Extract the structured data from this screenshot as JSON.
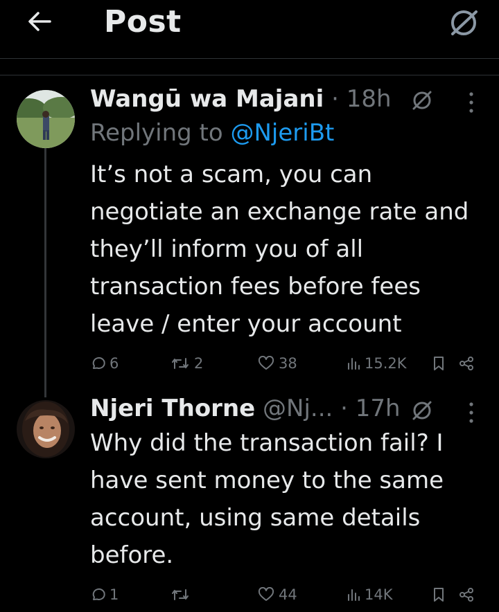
{
  "header": {
    "title": "Post"
  },
  "posts": [
    {
      "author_name": "Wangū wa Majani",
      "dot": "·",
      "time": "18h",
      "replying_prefix": "Replying to",
      "replying_handle": "@NjeriBt",
      "text": "It’s not a scam, you can negotiate an exchange rate and they’ll inform you of all transaction fees before fees leave / enter your account",
      "replies": "6",
      "reposts": "2",
      "likes": "38",
      "views": "15.2K"
    },
    {
      "author_name": "Njeri Thorne",
      "handle": "@Nj...",
      "dot": "·",
      "time": "17h",
      "text": "Why did the transaction fail? I have sent money to the same account, using same details before.",
      "replies": "1",
      "reposts": "",
      "likes": "44",
      "views": "14K"
    }
  ],
  "colors": {
    "background": "#000000",
    "text": "#e7e9ea",
    "muted": "#71767b",
    "link": "#1d9bf0",
    "divider": "#2f3336"
  },
  "icons": [
    "back-arrow-icon",
    "grok-icon",
    "more-icon",
    "reply-icon",
    "repost-icon",
    "like-icon",
    "views-icon",
    "bookmark-icon",
    "share-icon"
  ]
}
